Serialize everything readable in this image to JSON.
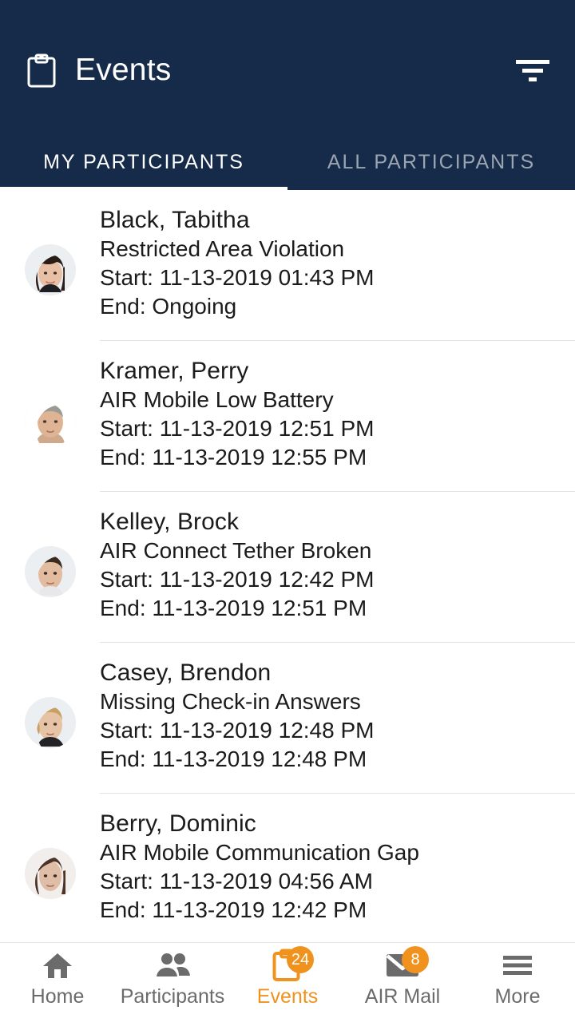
{
  "header": {
    "title": "Events",
    "icon": "clipboard-icon",
    "filter_icon": "filter-icon",
    "background_color": "#162b49"
  },
  "tabs": [
    {
      "label": "MY PARTICIPANTS",
      "active": true
    },
    {
      "label": "ALL PARTICIPANTS",
      "active": false
    }
  ],
  "events": [
    {
      "name": "Black, Tabitha",
      "type": "Restricted Area Violation",
      "start": "Start: 11-13-2019 01:43 PM",
      "end": "End: Ongoing",
      "avatar": "avatar-black-tabitha"
    },
    {
      "name": "Kramer, Perry",
      "type": "AIR Mobile Low Battery",
      "start": "Start: 11-13-2019 12:51 PM",
      "end": "End: 11-13-2019 12:55 PM",
      "avatar": "avatar-kramer-perry"
    },
    {
      "name": "Kelley, Brock",
      "type": "AIR Connect Tether Broken",
      "start": "Start: 11-13-2019 12:42 PM",
      "end": "End: 11-13-2019 12:51 PM",
      "avatar": "avatar-kelley-brock"
    },
    {
      "name": "Casey, Brendon",
      "type": "Missing Check-in Answers",
      "start": "Start: 11-13-2019 12:48 PM",
      "end": "End: 11-13-2019 12:48 PM",
      "avatar": "avatar-casey-brendon"
    },
    {
      "name": "Berry, Dominic",
      "type": "AIR Mobile Communication Gap",
      "start": "Start: 11-13-2019 04:56 AM",
      "end": "End: 11-13-2019 12:42 PM",
      "avatar": "avatar-berry-dominic"
    }
  ],
  "bottom_nav": {
    "accent_color": "#f0931e",
    "inactive_color": "#6b6b6b",
    "items": [
      {
        "label": "Home",
        "icon": "home-icon",
        "badge": "",
        "active": false
      },
      {
        "label": "Participants",
        "icon": "people-icon",
        "badge": "",
        "active": false
      },
      {
        "label": "Events",
        "icon": "clipboard-icon",
        "badge": "24",
        "active": true
      },
      {
        "label": "AIR Mail",
        "icon": "envelope-icon",
        "badge": "8",
        "active": false
      },
      {
        "label": "More",
        "icon": "hamburger-icon",
        "badge": "",
        "active": false
      }
    ]
  }
}
